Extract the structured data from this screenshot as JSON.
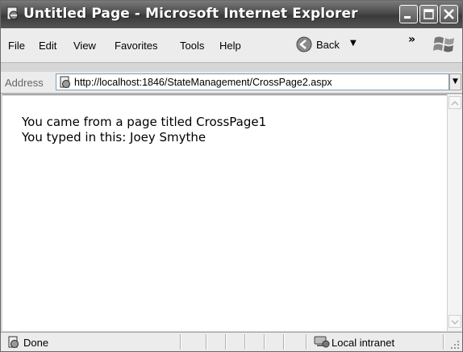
{
  "window": {
    "title": "Untitled Page - Microsoft Internet Explorer"
  },
  "menu": {
    "items": [
      "File",
      "Edit",
      "View",
      "Favorites",
      "Tools",
      "Help"
    ],
    "back_label": "Back",
    "more": "»"
  },
  "address": {
    "label": "Address",
    "url": "http://localhost:1846/StateManagement/CrossPage2.aspx"
  },
  "page": {
    "line1": "You came from a page titled CrossPage1",
    "line2": "You typed in this: Joey Smythe"
  },
  "status": {
    "text": "Done",
    "zone": "Local intranet"
  }
}
